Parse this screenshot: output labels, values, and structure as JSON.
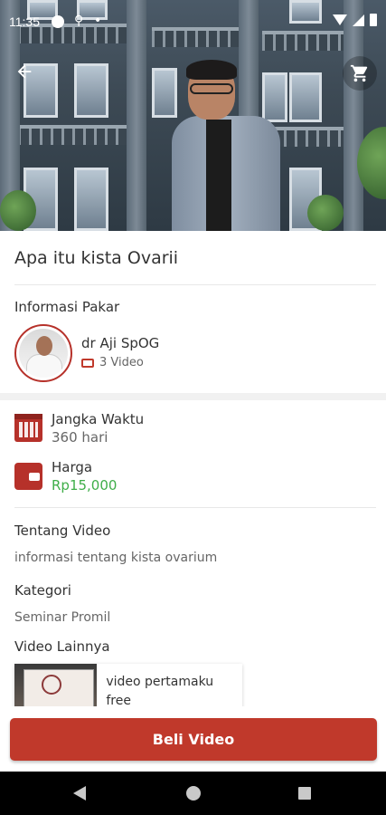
{
  "status_bar": {
    "time": "11:35"
  },
  "header": {
    "back_icon": "arrow-left-icon",
    "cart_icon": "cart-icon"
  },
  "product": {
    "title": "Apa itu kista Ovarii"
  },
  "expert": {
    "section_label": "Informasi Pakar",
    "name": "dr Aji SpOG",
    "video_count": "3 Video"
  },
  "details": {
    "duration_label": "Jangka Waktu",
    "duration_value": "360 hari",
    "price_label": "Harga",
    "price_value": "Rp15,000"
  },
  "about": {
    "label": "Tentang Video",
    "text": "informasi tentang kista ovarium"
  },
  "category": {
    "label": "Kategori",
    "value": "Seminar Promil"
  },
  "other_videos": {
    "label": "Video Lainnya",
    "items": [
      {
        "title": "video pertamaku free"
      }
    ]
  },
  "actions": {
    "buy_label": "Beli Video"
  },
  "colors": {
    "accent": "#c0392b",
    "price": "#3fae49"
  }
}
